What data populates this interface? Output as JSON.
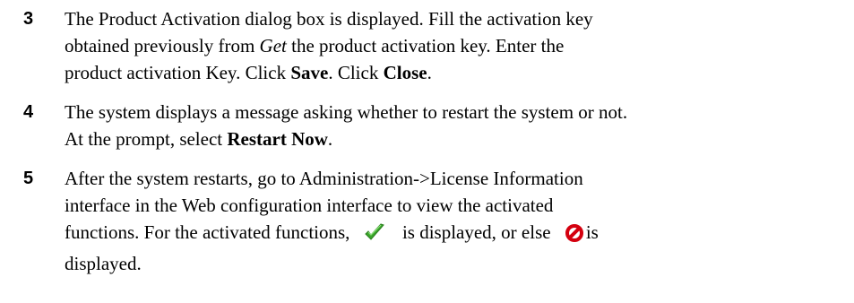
{
  "steps": [
    {
      "number": "3",
      "lines": [
        [
          "The Product Activation dialog box is displayed. Fill the activation key"
        ],
        [
          "obtained previously from ",
          "Get",
          " the product activation key. Enter the"
        ],
        [
          "product activation Key. Click ",
          "Save",
          ". Click ",
          "Close",
          "."
        ]
      ]
    },
    {
      "number": "4",
      "lines": [
        [
          "The system displays a message asking whether to restart the system or not."
        ],
        [
          "At the prompt, select ",
          "Restart Now",
          "."
        ]
      ]
    },
    {
      "number": "5",
      "lines": [
        [
          "After the system restarts, go to Administration->License Information"
        ],
        [
          "interface in the Web configuration interface to view the activated"
        ],
        [
          "functions. For the activated functions, ",
          " is displayed, or else ",
          "is"
        ],
        [
          "displayed."
        ]
      ]
    }
  ],
  "icons": {
    "activated": "check-icon",
    "not_activated": "prohibited-icon",
    "check_color": "#3aa52a",
    "prohibited_color": "#d4000f"
  }
}
